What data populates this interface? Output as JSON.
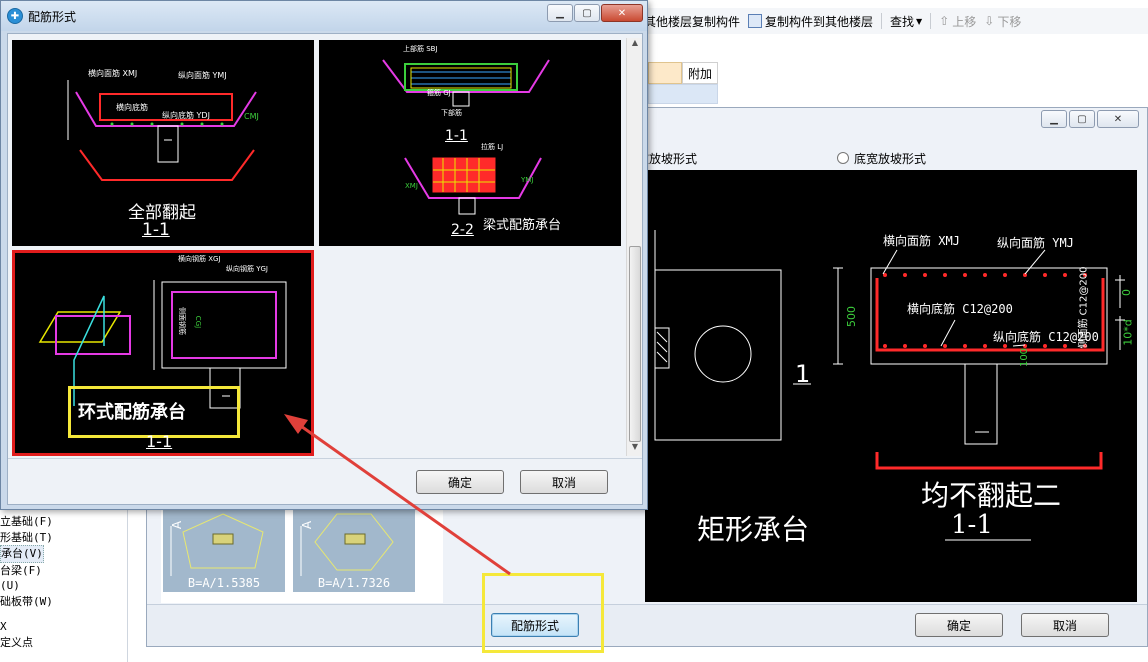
{
  "toolbar": {
    "copy_from_label": "其他楼层复制构件",
    "copy_to_label": "复制构件到其他楼层",
    "find_label": "查找",
    "up_label": "上移",
    "down_label": "下移"
  },
  "grid": {
    "extra_header": "附加"
  },
  "left_tree": {
    "items": [
      "立基础(F)",
      "形基础(T)",
      "承台(V)",
      "台梁(F)",
      "(U)",
      "础板带(W)",
      "X",
      "定义点"
    ],
    "selected_index": 2
  },
  "main_dialog": {
    "radio_option_1": "坡放坡形式",
    "radio_option_2": "底宽放坡形式",
    "cad_big": {
      "horiz_rebar": "横向面筋 XMJ",
      "long_rebar": "纵向面筋 YMJ",
      "horiz_bottom": "横向底筋 C12@200",
      "long_bottom": "纵向底筋 C12@200",
      "dim_500": "500",
      "dim_0": "0",
      "dim_10d": "10*d",
      "dim_100": "100",
      "side_rebar": "侧面筋 C12@200",
      "section_mark": "1",
      "caption_uneven": "均不翻起二",
      "caption_uneven_section": "1-1",
      "caption_rect": "矩形承台"
    },
    "thumb_1_label": "B=A/1.5385",
    "thumb_2_label": "B=A/1.7326",
    "thumb_axis": "A",
    "rebar_form_button": "配筋形式",
    "ok_button": "确定",
    "cancel_button": "取消"
  },
  "rebar_dialog": {
    "title": "配筋形式",
    "panel_1": {
      "caption": "全部翻起",
      "section": "1-1",
      "labels": [
        "横向面筋 XMJ",
        "纵向面筋 YMJ",
        "横向底筋",
        "纵向底筋 YDJ",
        "CMJ"
      ]
    },
    "panel_2": {
      "caption": "梁式配筋承台",
      "section_1": "1-1",
      "section_2": "2-2",
      "labels": [
        "上部筋 SBJ",
        "下部筋",
        "箍筋 GJ",
        "拉筋 LJ",
        "XMJ",
        "YMJ"
      ]
    },
    "panel_3": {
      "caption": "环式配筋承台",
      "section": "1-1",
      "labels": [
        "横向钢筋 XGJ",
        "纵向钢筋 YGJ",
        "侧面钢筋",
        "CGJ"
      ]
    },
    "ok_button": "确定",
    "cancel_button": "取消"
  },
  "colors": {
    "selection_red": "#e01c1c",
    "highlight_yellow": "#f5e83a",
    "arrow_red": "#e0403a",
    "cad_green": "#3ccf3c",
    "cad_magenta": "#e53ae5",
    "cad_red": "#ff2a2a"
  }
}
